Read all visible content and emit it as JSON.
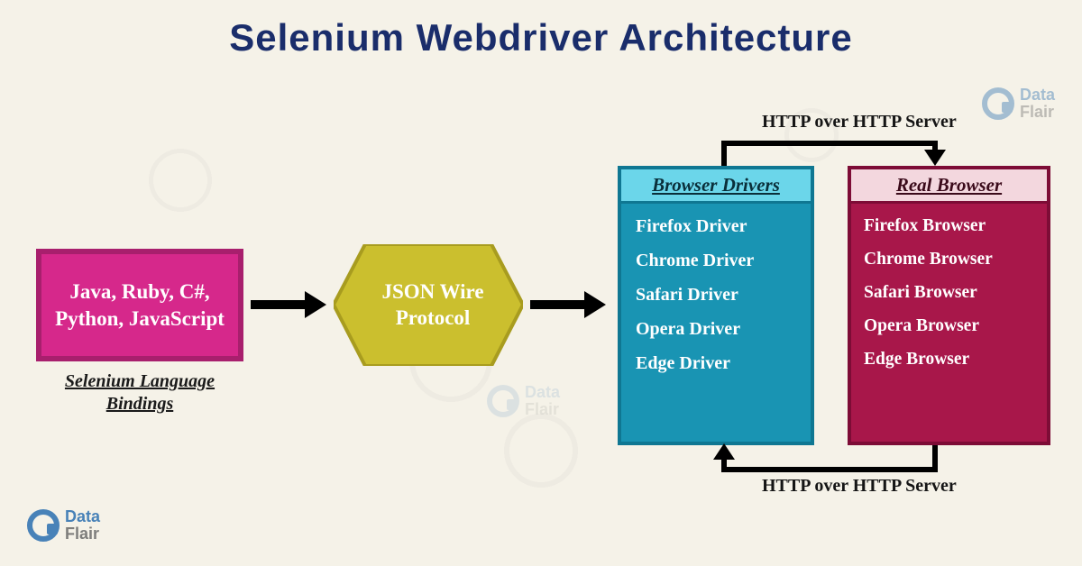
{
  "title": "Selenium Webdriver Architecture",
  "languages": {
    "text": "Java, Ruby, C#, Python, JavaScript",
    "caption": "Selenium Language Bindings"
  },
  "protocol": {
    "text": "JSON Wire Protocol"
  },
  "drivers": {
    "header": "Browser Drivers",
    "items": [
      "Firefox Driver",
      "Chrome Driver",
      "Safari Driver",
      "Opera Driver",
      "Edge Driver"
    ]
  },
  "browsers": {
    "header": "Real Browser",
    "items": [
      "Firefox Browser",
      "Chrome Browser",
      "Safari Browser",
      "Opera Browser",
      "Edge Browser"
    ]
  },
  "connector_label_top": "HTTP over HTTP Server",
  "connector_label_bottom": "HTTP over HTTP Server",
  "brand": {
    "line1": "Data",
    "line2": "Flair"
  }
}
